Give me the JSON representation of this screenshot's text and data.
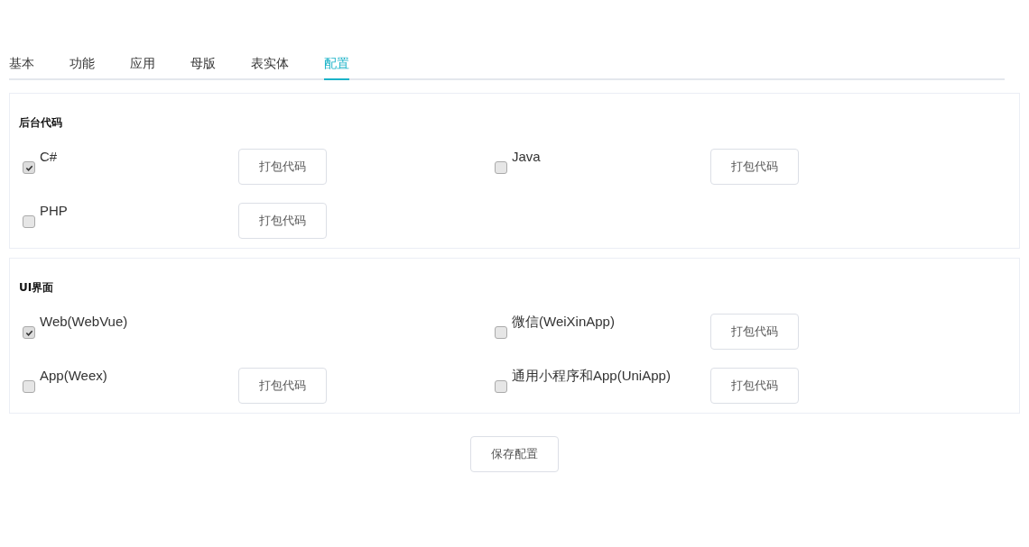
{
  "tabs": [
    {
      "label": "基本",
      "selected": false
    },
    {
      "label": "功能",
      "selected": false
    },
    {
      "label": "应用",
      "selected": false
    },
    {
      "label": "母版",
      "selected": false
    },
    {
      "label": "表实体",
      "selected": false
    },
    {
      "label": "配置",
      "selected": true
    }
  ],
  "sections": [
    {
      "title": "后台代码",
      "items": [
        {
          "label": "C#",
          "checked": true,
          "button": "打包代码"
        },
        {
          "label": "Java",
          "checked": false,
          "button": "打包代码"
        },
        {
          "label": "PHP",
          "checked": false,
          "button": "打包代码"
        }
      ]
    },
    {
      "title": "UI界面",
      "items": [
        {
          "label": "Web(WebVue)",
          "checked": true
        },
        {
          "label": "微信(WeiXinApp)",
          "checked": false,
          "button": "打包代码"
        },
        {
          "label": "App(Weex)",
          "checked": false,
          "button": "打包代码"
        },
        {
          "label": "通用小程序和App(UniApp)",
          "checked": false,
          "button": "打包代码"
        }
      ]
    }
  ],
  "save_button": "保存配置"
}
